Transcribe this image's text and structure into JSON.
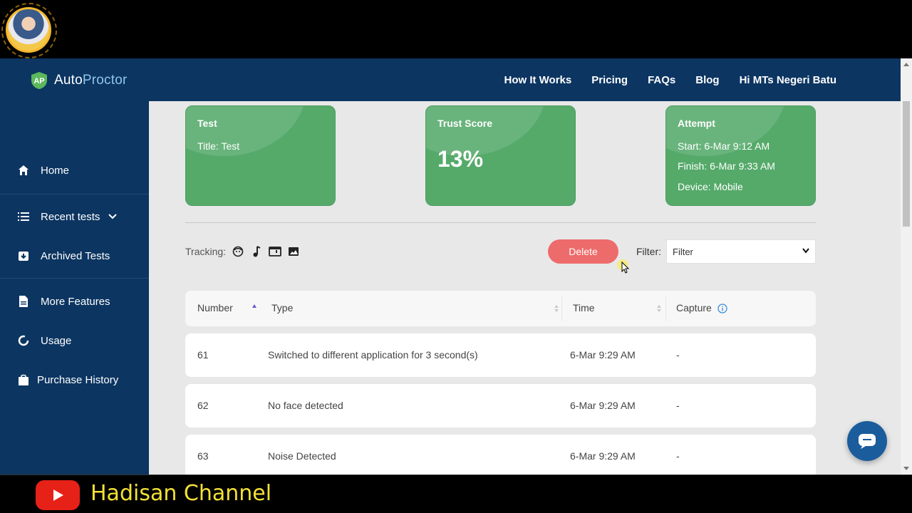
{
  "brand": {
    "name_a": "Auto",
    "name_b": "Proctor"
  },
  "nav": [
    "How It Works",
    "Pricing",
    "FAQs",
    "Blog",
    "Hi MTs Negeri Batu"
  ],
  "sidebar": {
    "items": [
      {
        "label": "Home",
        "icon": "home-icon"
      },
      {
        "label": "Recent tests",
        "icon": "list-icon"
      },
      {
        "label": "Archived Tests",
        "icon": "archive-icon"
      },
      {
        "label": "More Features",
        "icon": "document-icon"
      },
      {
        "label": "Usage",
        "icon": "usage-icon"
      },
      {
        "label": "Purchase History",
        "icon": "bag-icon"
      }
    ]
  },
  "cards": {
    "test": {
      "title": "Test",
      "line1": "Title: Test"
    },
    "trust": {
      "title": "Trust Score",
      "value": "13%"
    },
    "attempt": {
      "title": "Attempt",
      "start": "Start: 6-Mar 9:12 AM",
      "finish": "Finish: 6-Mar 9:33 AM",
      "device": "Device: Mobile"
    }
  },
  "tracking": {
    "label": "Tracking:",
    "icons": [
      "face-icon",
      "music-note-icon",
      "browser-tab-icon",
      "image-icon"
    ]
  },
  "actions": {
    "delete_label": "Delete",
    "filter_label": "Filter:",
    "filter_value": "Filter"
  },
  "table": {
    "headers": {
      "number": "Number",
      "type": "Type",
      "time": "Time",
      "capture": "Capture"
    },
    "rows": [
      {
        "number": "61",
        "type": "Switched to different application for 3 second(s)",
        "time": "6-Mar 9:29 AM",
        "capture": "-"
      },
      {
        "number": "62",
        "type": "No face detected",
        "time": "6-Mar 9:29 AM",
        "capture": "-"
      },
      {
        "number": "63",
        "type": "Noise Detected",
        "time": "6-Mar 9:29 AM",
        "capture": "-"
      }
    ]
  },
  "overlay": {
    "channel": "Hadisan Channel"
  },
  "colors": {
    "header": "#0c3561",
    "card": "#55aa6a",
    "delete": "#ee6b6b",
    "channel_text": "#f3e135"
  }
}
